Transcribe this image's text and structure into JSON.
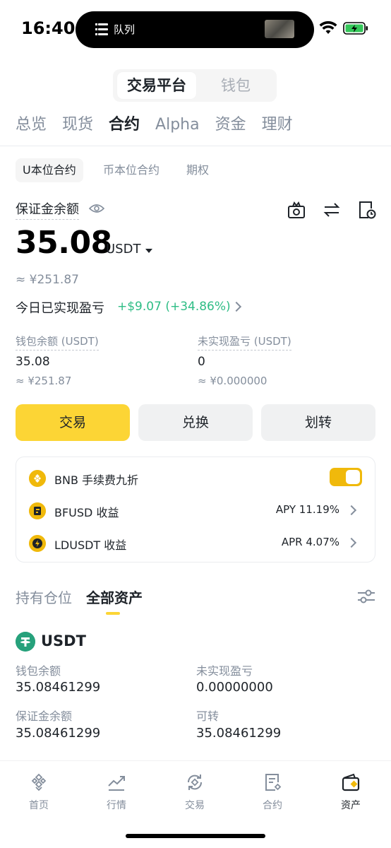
{
  "status_bar": {
    "time": "16:40",
    "island_label": "队列"
  },
  "top_toggle": {
    "active": "交易平台",
    "inactive": "钱包"
  },
  "main_tabs": [
    "总览",
    "现货",
    "合约",
    "Alpha",
    "资金",
    "理财"
  ],
  "main_tabs_active": "合约",
  "sub_tabs": [
    "U本位合约",
    "币本位合约",
    "期权"
  ],
  "sub_tabs_active": "U本位合约",
  "balance": {
    "label": "保证金余额",
    "amount": "35.08",
    "unit": "USDT",
    "approx": "≈ ¥251.87",
    "pnl_label": "今日已实现盈亏",
    "pnl_value": "+$9.07 (+34.86%)"
  },
  "stats": {
    "wallet_label": "钱包余额 (USDT)",
    "wallet_value": "35.08",
    "wallet_approx": "≈ ¥251.87",
    "unrealized_label": "未实现盈亏 (USDT)",
    "unrealized_value": "0",
    "unrealized_approx": "≈ ¥0.000000"
  },
  "actions": {
    "trade": "交易",
    "convert": "兑换",
    "transfer": "划转"
  },
  "card": {
    "bnb_label": "BNB 手续费九折",
    "bnb_toggle_on": true,
    "bfusd_label": "BFUSD 收益",
    "bfusd_value": "APY 11.19%",
    "ldusdt_label": "LDUSDT 收益",
    "ldusdt_value": "APR 4.07%"
  },
  "asset_tabs": {
    "positions": "持有仓位",
    "all_assets": "全部资产"
  },
  "asset": {
    "name": "USDT",
    "wallet_label": "钱包余额",
    "wallet_value": "35.08461299",
    "unrealized_label": "未实现盈亏",
    "unrealized_value": "0.00000000",
    "margin_label": "保证金余额",
    "margin_value": "35.08461299",
    "transferable_label": "可转",
    "transferable_value": "35.08461299"
  },
  "bottom_nav": {
    "home": "首页",
    "markets": "行情",
    "trade": "交易",
    "futures": "合约",
    "assets": "资产"
  },
  "colors": {
    "brand_yellow": "#fcd535",
    "profit_green": "#2ebd85",
    "bnb_gold": "#f0b90b",
    "usdt_green": "#26a17b"
  }
}
